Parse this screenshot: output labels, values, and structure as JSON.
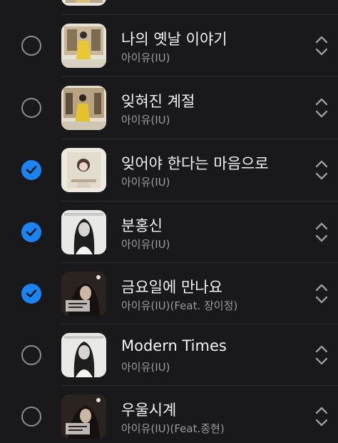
{
  "songs": [
    {
      "title": "나의 옛날 이야기",
      "artist": "아이유(IU)",
      "checked": false,
      "art": "yellow-dress"
    },
    {
      "title": "잊혀진 계절",
      "artist": "아이유(IU)",
      "checked": false,
      "art": "yellow-dress"
    },
    {
      "title": "잊어야 한다는 마음으로",
      "artist": "아이유(IU)",
      "checked": true,
      "art": "pale-portrait"
    },
    {
      "title": "분홍신",
      "artist": "아이유(IU)",
      "checked": true,
      "art": "modern-times"
    },
    {
      "title": "금요일에 만나요",
      "artist": "아이유(IU)(Feat. 장이정)",
      "checked": true,
      "art": "modern-times-epilogue"
    },
    {
      "title": "Modern Times",
      "artist": "아이유(IU)",
      "checked": false,
      "art": "modern-times"
    },
    {
      "title": "우울시계",
      "artist": "아이유(IU)(Feat.종현)",
      "checked": false,
      "art": "modern-times-epilogue"
    }
  ],
  "colors": {
    "background": "#19191b",
    "accent": "#1a84f5",
    "title": "#f2f2f4",
    "subtitle": "#9b9ba0"
  },
  "icons": {
    "checkbox": "circle-checkbox-icon",
    "checked": "checkmark-icon",
    "reorder": "reorder-handle-icon"
  }
}
